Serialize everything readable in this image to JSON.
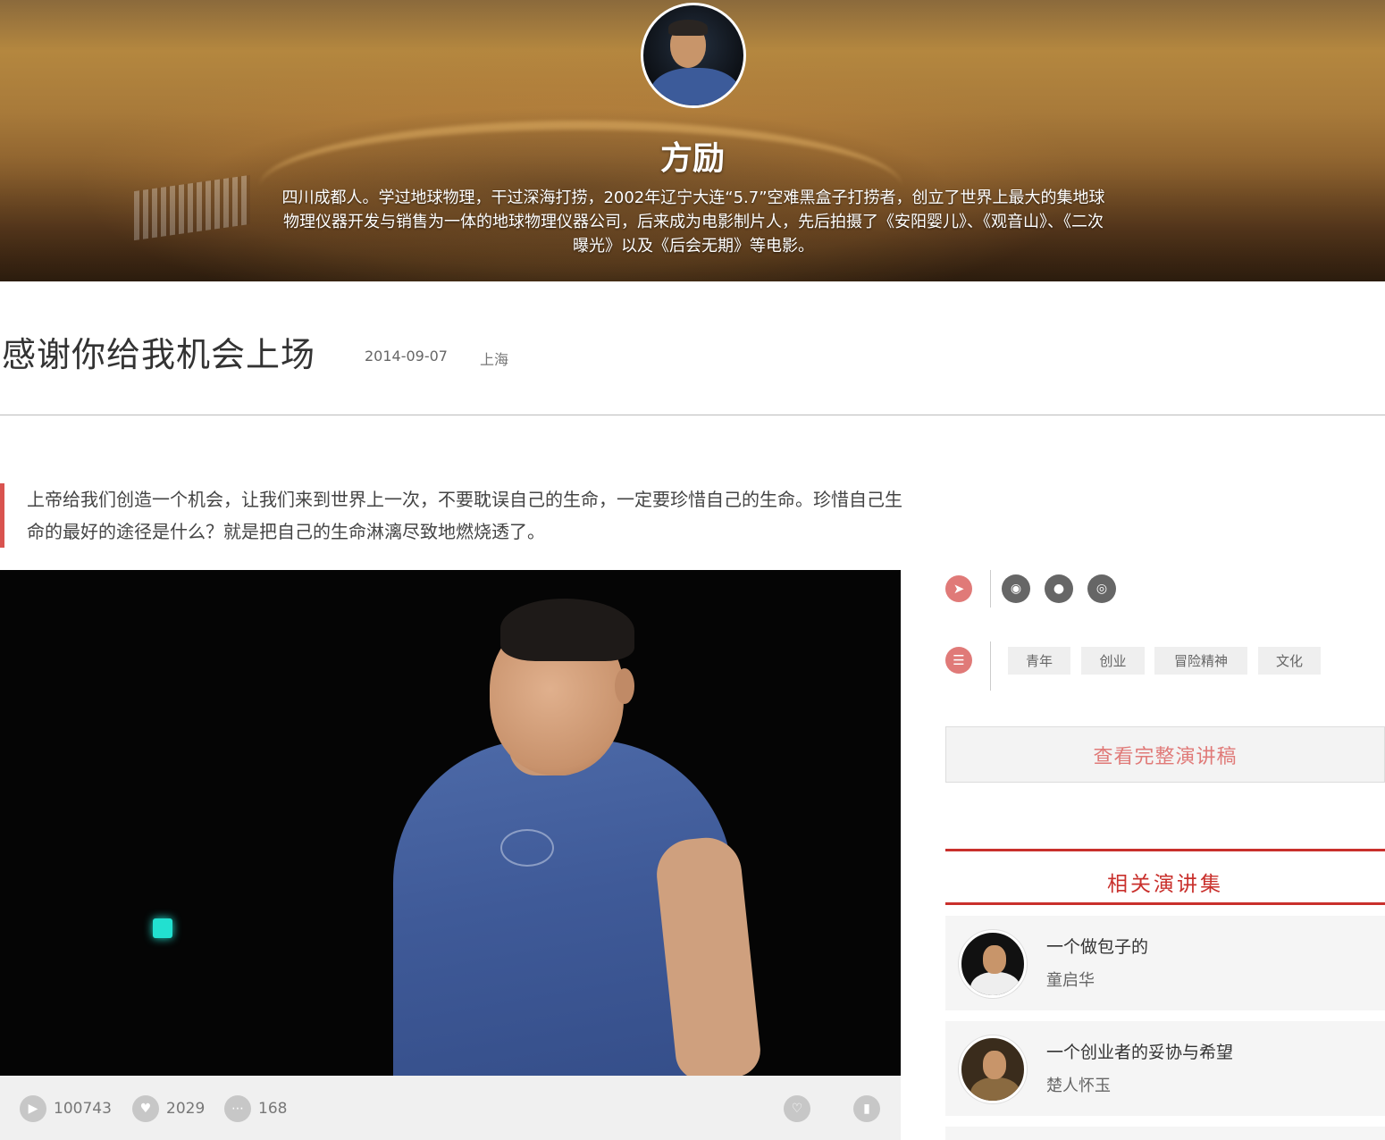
{
  "speaker": {
    "name": "方励",
    "bio": "四川成都人。学过地球物理，干过深海打捞，2002年辽宁大连“5.7”空难黑盒子打捞者，创立了世界上最大的集地球物理仪器开发与销售为一体的地球物理仪器公司，后来成为电影制片人，先后拍摄了《安阳婴儿》、《观音山》、《二次曝光》以及《后会无期》等电影。"
  },
  "talk": {
    "title": "感谢你给我机会上场",
    "date": "2014-09-07",
    "city": "上海",
    "quote": "上帝给我们创造一个机会，让我们来到世界上一次，不要耽误自己的生命，一定要珍惜自己的生命。珍惜自己生命的最好的途径是什么？就是把自己的生命淋漓尽致地燃烧透了。"
  },
  "stats": {
    "plays": "100743",
    "likes": "2029",
    "comments": "168"
  },
  "tags": [
    "青年",
    "创业",
    "冒险精神",
    "文化"
  ],
  "transcript_button": "查看完整演讲稿",
  "related": {
    "heading": "相关演讲集",
    "items": [
      {
        "title": "一个做包子的",
        "speaker": "童启华"
      },
      {
        "title": "一个创业者的妥协与希望",
        "speaker": "楚人怀玉"
      }
    ]
  },
  "icons": {
    "share": "share-icon",
    "weibo": "weibo-icon",
    "wechat": "wechat-icon",
    "pengyou": "friends-circle-icon",
    "tags": "list-icon",
    "play": "play-icon",
    "like": "heart-icon",
    "comment": "comment-icon",
    "favorite": "heart-icon",
    "bookmark": "bookmark-icon"
  },
  "colors": {
    "accent": "#c9302c",
    "accent_light": "#e07a78",
    "quote_bar": "#d9534f"
  }
}
